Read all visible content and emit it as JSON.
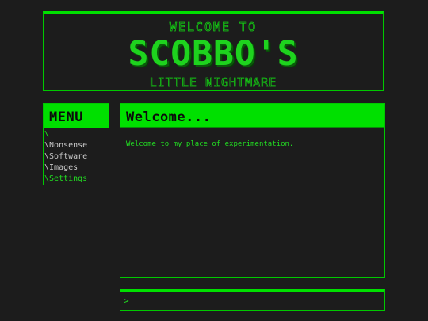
{
  "banner": {
    "top": "WELCOME TO",
    "title": "SCOBBO'S",
    "subtitle": "LITTLE NIGHTMARE"
  },
  "menu": {
    "title": "MENU",
    "root": "\\",
    "items": [
      {
        "slash": "\\",
        "label": "Nonsense",
        "active": false
      },
      {
        "slash": "\\",
        "label": "Software",
        "active": false
      },
      {
        "slash": "\\",
        "label": "Images",
        "active": false
      },
      {
        "slash": "\\",
        "label": "Settings",
        "active": true
      }
    ]
  },
  "content": {
    "title": "Welcome...",
    "body": "Welcome to my place of experimentation."
  },
  "console": {
    "prompt": ">",
    "value": ""
  },
  "colors": {
    "background": "#1c1c1c",
    "accent": "#00e000",
    "text_green": "#22dd22",
    "menu_text": "#c8c8c8"
  }
}
